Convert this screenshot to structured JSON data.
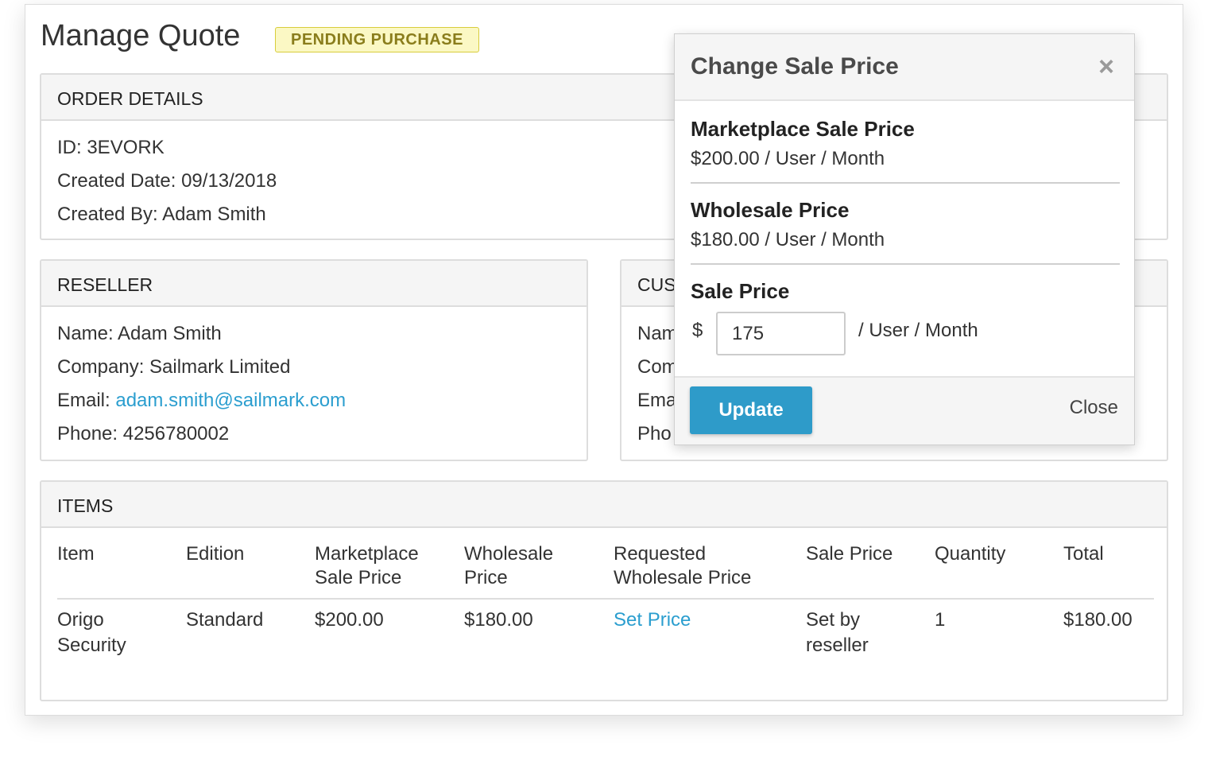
{
  "header": {
    "title": "Manage Quote",
    "status": "PENDING PURCHASE"
  },
  "order_details": {
    "title": "ORDER DETAILS",
    "id": "ID: 3EVORK",
    "created_date": "Created Date: 09/13/2018",
    "created_by": "Created By: Adam Smith"
  },
  "reseller": {
    "title": "RESELLER",
    "name": "Name: Adam Smith",
    "company": "Company: Sailmark Limited",
    "email_label": "Email: ",
    "email": "adam.smith@sailmark.com",
    "phone": "Phone: 4256780002"
  },
  "customer": {
    "title": "CUS",
    "name": "Nam",
    "company": "Com",
    "email": "Ema",
    "phone": "Pho"
  },
  "items": {
    "title": "ITEMS",
    "columns": {
      "item": "Item",
      "edition": "Edition",
      "marketplace_line1": "Marketplace",
      "marketplace_line2": "Sale Price",
      "wholesale_line1": "Wholesale",
      "wholesale_line2": "Price",
      "requested_line1": "Requested",
      "requested_line2": "Wholesale Price",
      "sale_price": "Sale Price",
      "quantity": "Quantity",
      "total": "Total"
    },
    "rows": [
      {
        "item_line1": "Origo",
        "item_line2": "Security",
        "edition": "Standard",
        "marketplace": "$200.00",
        "wholesale": "$180.00",
        "requested": "Set Price",
        "sale_line1": "Set by",
        "sale_line2": "reseller",
        "quantity": "1",
        "total": "$180.00"
      }
    ]
  },
  "modal": {
    "title": "Change Sale Price",
    "close_glyph": "×",
    "marketplace_label": "Marketplace Sale Price",
    "marketplace_value": "$200.00 / User / Month",
    "wholesale_label": "Wholesale Price",
    "wholesale_value": "$180.00 / User / Month",
    "sale_label": "Sale Price",
    "currency": "$",
    "sale_value": "175",
    "unit": "/ User / Month",
    "update_label": "Update",
    "close_label": "Close"
  },
  "colors": {
    "accent": "#2e9bc9",
    "link": "#2b9ecf",
    "badge_bg": "#fbf8c4",
    "badge_border": "#d8cd3c",
    "badge_text": "#8a7d1c"
  }
}
